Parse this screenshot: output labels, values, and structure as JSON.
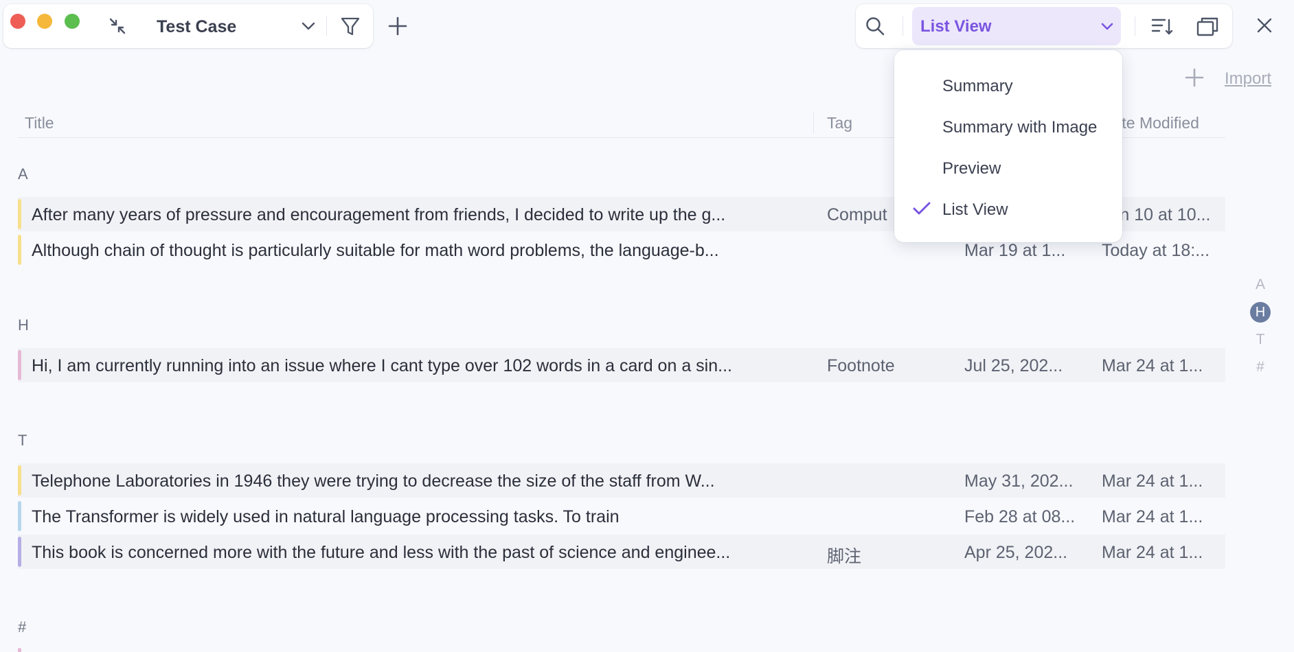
{
  "toolbar": {
    "collection_title": "Test Case",
    "view_selected": "List View",
    "import_label": "Import"
  },
  "view_menu": {
    "items": [
      {
        "label": "Summary",
        "checked": false
      },
      {
        "label": "Summary with Image",
        "checked": false
      },
      {
        "label": "Preview",
        "checked": false
      },
      {
        "label": "List View",
        "checked": true
      }
    ]
  },
  "columns": {
    "title": "Title",
    "tag": "Tag",
    "date_modified": "Date Modified"
  },
  "groups": [
    {
      "letter": "A",
      "rows": [
        {
          "title": "After many years of pressure and encouragement from friends, I decided to write up the g...",
          "tag": "Comput",
          "date_created": "",
          "date_modified": "Jun 10 at 10...",
          "color": "#f7df8c"
        },
        {
          "title": "Although chain of thought is particularly suitable for math word problems, the language-b...",
          "tag": "",
          "date_created": "Mar 19 at 1...",
          "date_modified": "Today at 18:...",
          "color": "#f7df8c"
        }
      ]
    },
    {
      "letter": "H",
      "rows": [
        {
          "title": "Hi, I am currently running into an issue where I cant type over 102 words in a card on a sin...",
          "tag": "Footnote",
          "date_created": "Jul 25, 202...",
          "date_modified": "Mar 24 at 1...",
          "color": "#e6b9d4"
        }
      ]
    },
    {
      "letter": "T",
      "rows": [
        {
          "title": "Telephone Laboratories in 1946 they were trying to decrease the size of the staff from W...",
          "tag": "",
          "date_created": "May 31, 202...",
          "date_modified": "Mar 24 at 1...",
          "color": "#f7df8c"
        },
        {
          "title": "The Transformer is widely used in natural language processing tasks. To train",
          "tag": "",
          "date_created": "Feb 28 at 08...",
          "date_modified": "Mar 24 at 1...",
          "color": "#b7d7ec"
        },
        {
          "title": "This book is concerned more with the future and less with the past of science and enginee...",
          "tag": "脚注",
          "date_created": "Apr 25, 202...",
          "date_modified": "Mar 24 at 1...",
          "color": "#b7aee6"
        }
      ]
    },
    {
      "letter": "#",
      "rows": []
    }
  ],
  "index": [
    "A",
    "H",
    "T",
    "#"
  ],
  "index_active": "H",
  "colors": {
    "accent": "#7a55e0",
    "accent_bg": "#ece7fb",
    "close": "#ee5e55",
    "minimize": "#f5b83a",
    "zoom": "#5cbe4f"
  }
}
